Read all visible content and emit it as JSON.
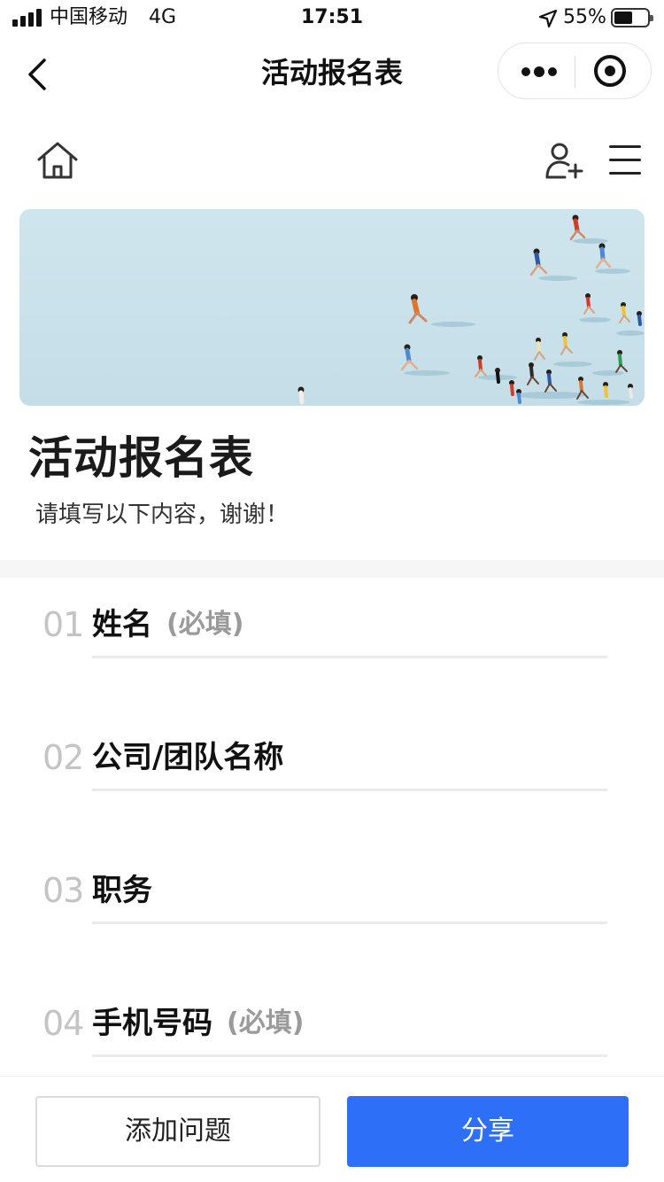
{
  "status_bar": {
    "carrier": "中国移动",
    "network": "4G",
    "time": "17:51",
    "battery_percent": "55%",
    "battery_level": 0.55,
    "icons": [
      "signal-icon",
      "location-arrow-icon",
      "battery-icon"
    ]
  },
  "nav": {
    "title": "活动报名表",
    "icons": [
      "back-arrow-icon",
      "more-dots-icon",
      "target-circle-icon"
    ]
  },
  "toolbar": {
    "icons": [
      "home-icon",
      "add-user-icon",
      "hamburger-menu-icon"
    ]
  },
  "banner": {
    "description_icon": "runners-banner-image"
  },
  "form": {
    "title": "活动报名表",
    "description": "请填写以下内容，谢谢！"
  },
  "questions": [
    {
      "number": "01",
      "label": "姓名",
      "required": "(必填)"
    },
    {
      "number": "02",
      "label": "公司/团队名称",
      "required": ""
    },
    {
      "number": "03",
      "label": "职务",
      "required": ""
    },
    {
      "number": "04",
      "label": "手机号码",
      "required": "(必填)"
    }
  ],
  "bottom": {
    "add_question_label": "添加问题",
    "share_label": "分享"
  },
  "colors": {
    "primary": "#2d6ff7",
    "number_gray": "#c4c4c4",
    "required_gray": "#9a9a9a",
    "banner_sky": "#cfe5ee"
  }
}
